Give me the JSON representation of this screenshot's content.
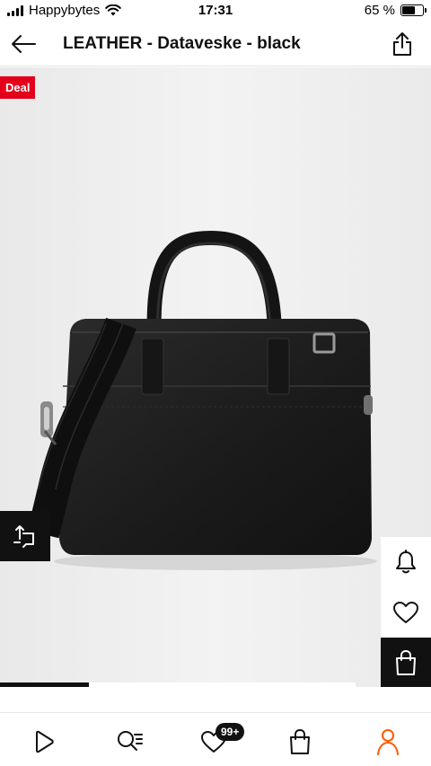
{
  "status_bar": {
    "carrier": "Happybytes",
    "time": "17:31",
    "battery_text": "65 %",
    "battery_level": 0.65
  },
  "header": {
    "title": "LEATHER - Dataveske - black",
    "back_icon": "arrow-left-icon",
    "share_icon": "share-icon"
  },
  "product": {
    "deal_label": "Deal",
    "image_position": 0.25
  },
  "side_actions": [
    {
      "icon": "bell-icon"
    },
    {
      "icon": "heart-icon"
    },
    {
      "icon": "shopping-bag-icon"
    }
  ],
  "bottom_nav": {
    "items": [
      {
        "icon": "play-icon"
      },
      {
        "icon": "search-list-icon"
      },
      {
        "icon": "heart-icon",
        "badge": "99+"
      },
      {
        "icon": "shopping-bag-icon"
      },
      {
        "icon": "person-icon"
      }
    ]
  },
  "colors": {
    "deal_red": "#e3001b",
    "accent_orange": "#ff5a00",
    "dark": "#111111",
    "image_bg": "#efefef"
  }
}
